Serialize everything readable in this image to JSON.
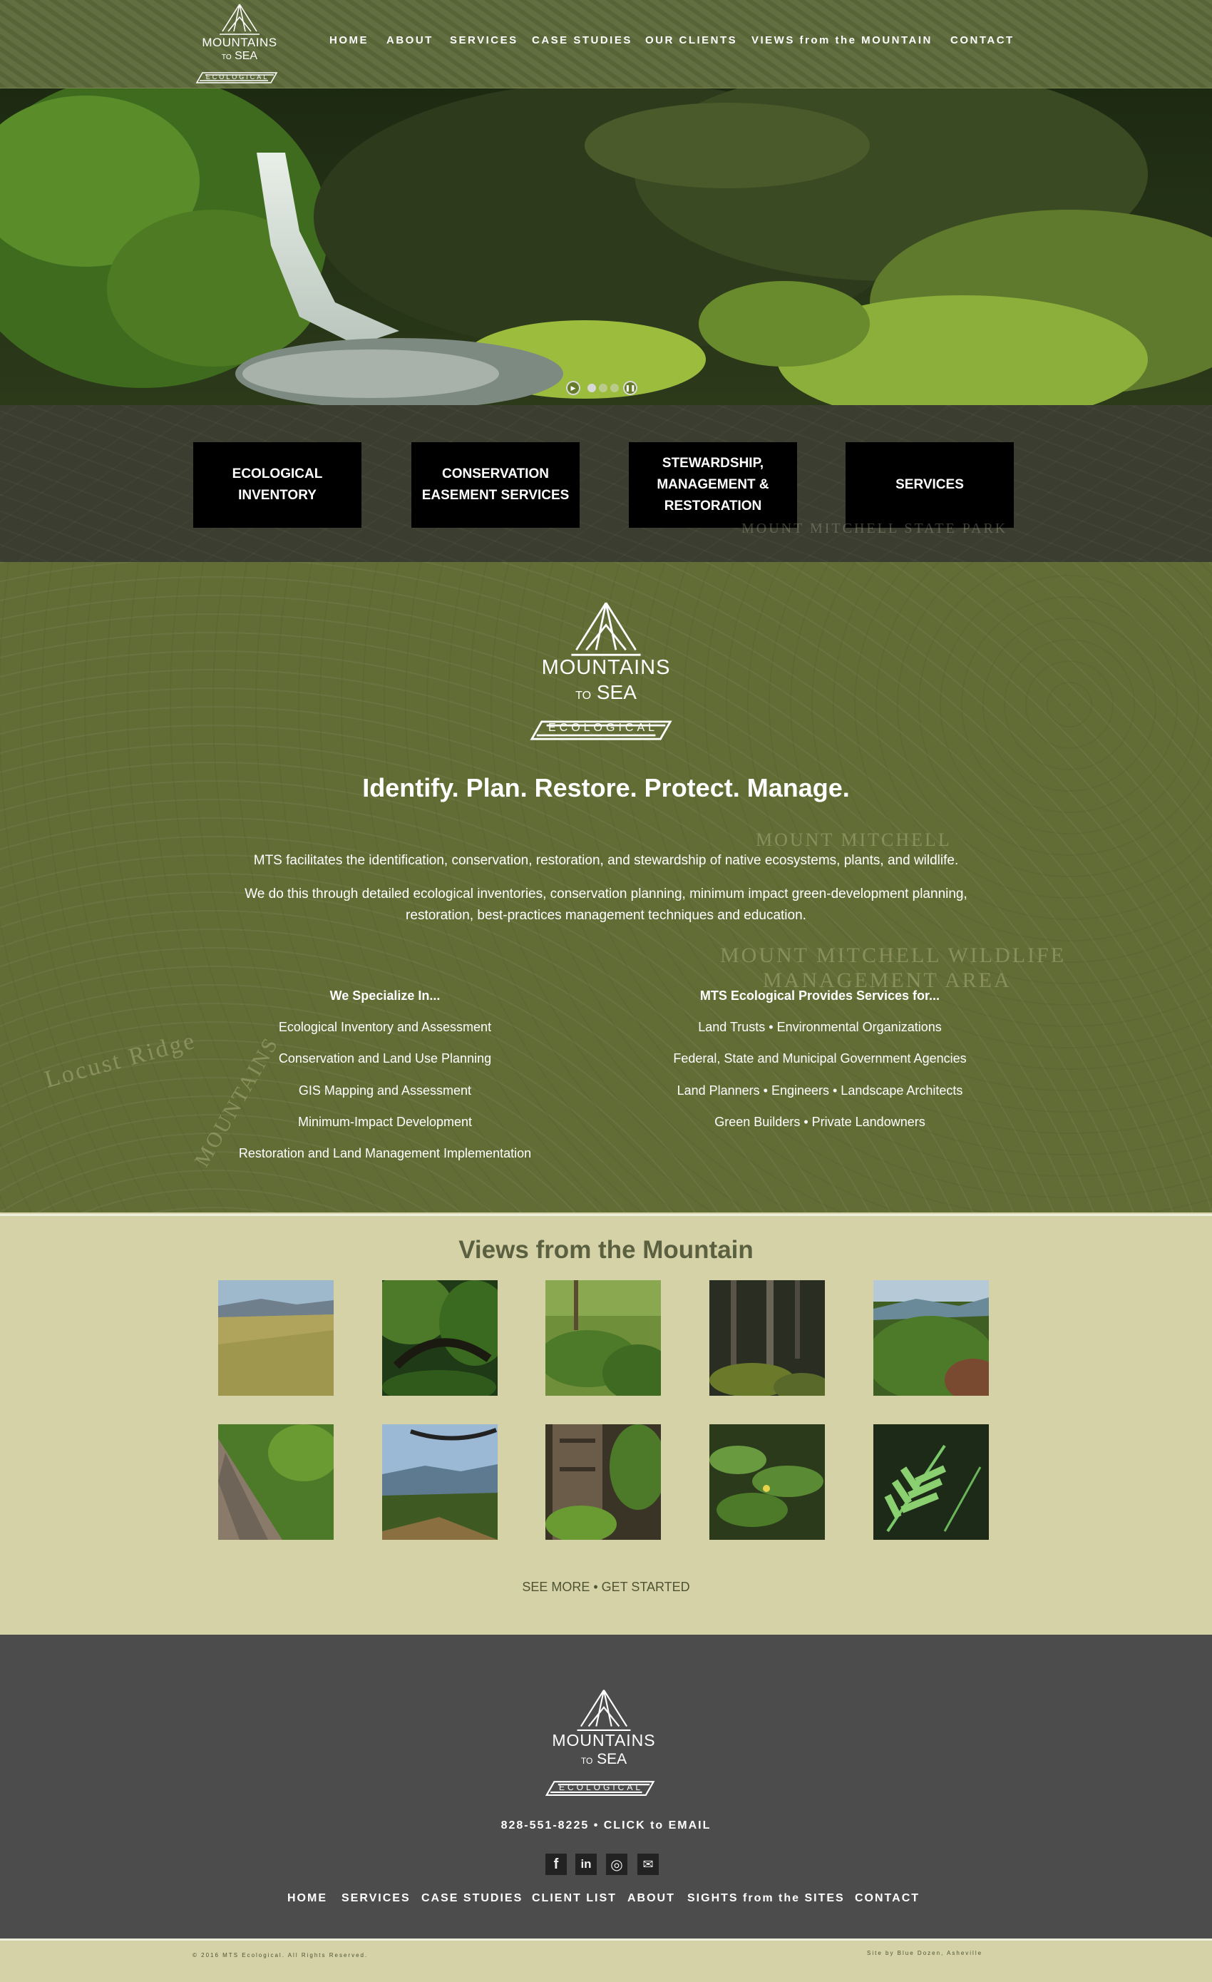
{
  "nav": {
    "home": "HOME",
    "about": "ABOUT",
    "services": "SERVICES",
    "case_studies": "CASE STUDIES",
    "our_clients": "OUR CLIENTS",
    "views": "VIEWS from the MOUNTAIN",
    "contact": "CONTACT"
  },
  "logo": {
    "line1": "MOUNTAINS",
    "line2_to": "TO",
    "line2_sea": "SEA",
    "line3": "ECOLOGICAL"
  },
  "service_buttons": [
    "ECOLOGICAL INVENTORY",
    "CONSERVATION EASEMENT SERVICES",
    "STEWARDSHIP, MANAGEMENT & RESTORATION",
    "SERVICES"
  ],
  "map_labels": {
    "park": "MOUNT MITCHELL STATE PARK",
    "mount_mitchell": "MOUNT MITCHELL",
    "wildlife": "MOUNT MITCHELL WILDLIFE",
    "area": "MANAGEMENT AREA",
    "ridge": "Locust Ridge",
    "mountains": "MOUNTAINS"
  },
  "intro": {
    "tagline": "Identify. Plan. Restore. Protect. Manage.",
    "para1": "MTS facilitates the identification, conservation, restoration, and stewardship of native ecosystems, plants, and wildlife.",
    "para2_line1": "We do this through detailed ecological inventories, conservation planning, minimum impact green-development planning,",
    "para2_line2": "restoration, best-practices management techniques and education."
  },
  "specialize": {
    "heading": "We Specialize In...",
    "items": [
      "Ecological Inventory and Assessment",
      "Conservation and Land Use Planning",
      "GIS Mapping and Assessment",
      "Minimum-Impact Development",
      "Restoration and Land Management Implementation"
    ]
  },
  "provides": {
    "heading": "MTS Ecological Provides Services for...",
    "items": [
      "Land Trusts • Environmental Organizations",
      "Federal, State and Municipal Government Agencies",
      "Land Planners • Engineers • Landscape Architects",
      "Green Builders • Private Landowners"
    ]
  },
  "views": {
    "title": "Views from the Mountain",
    "cta": "SEE MORE • GET STARTED"
  },
  "footer": {
    "contact": "828-551-8225 • CLICK to EMAIL",
    "social": [
      "f",
      "in",
      "◎",
      "✉"
    ],
    "nav": [
      "HOME",
      "SERVICES",
      "CASE STUDIES",
      "CLIENT LIST",
      "ABOUT",
      "SIGHTS from the SITES",
      "CONTACT"
    ],
    "copyright": "© 2016 MTS Ecological. All Rights Reserved.",
    "credit": "Site by Blue Dozen, Asheville"
  },
  "colors": {
    "header": "#5d6a3a",
    "map": "#626d36",
    "band": "#3a3d30",
    "cream": "#d4d2a6",
    "footer": "#4c4c4c",
    "views_title": "#5b6140"
  },
  "icons": [
    "mountains-logo-icon",
    "play-icon",
    "pause-icon",
    "facebook-icon",
    "linkedin-icon",
    "instagram-icon",
    "email-icon"
  ]
}
